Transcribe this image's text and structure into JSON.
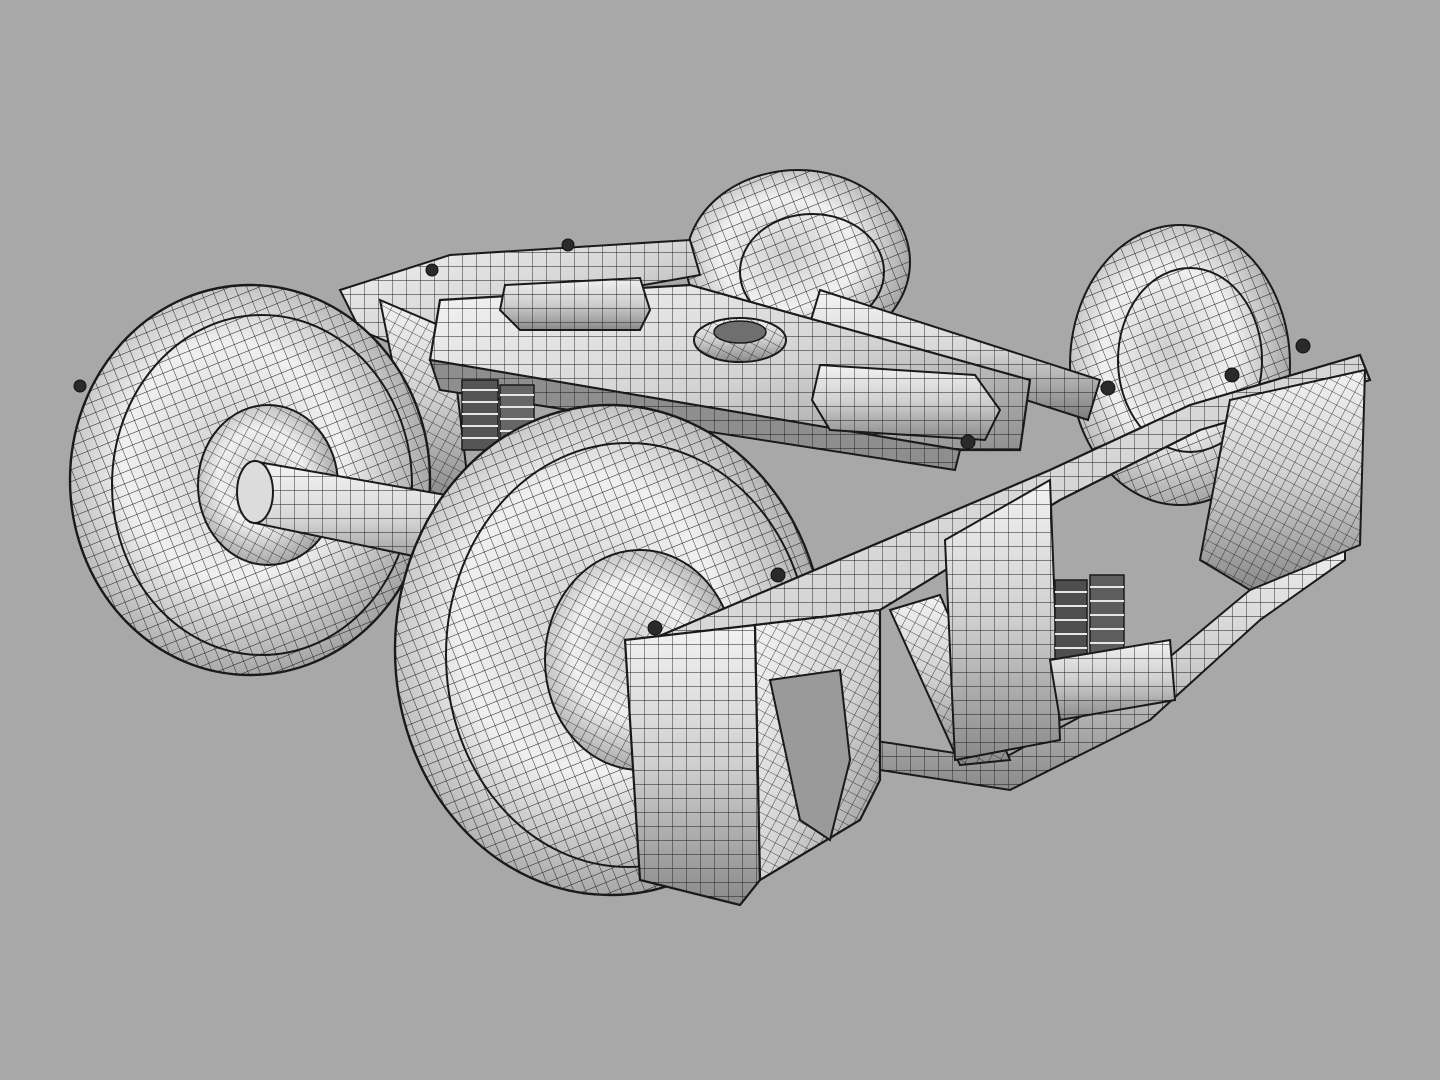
{
  "viewport": {
    "background": "#a8a8a8",
    "shade_light": "#f2f2f2",
    "shade_mid": "#cfcfcf",
    "shade_dark": "#8e8e8e",
    "wire": "#1a1a1a"
  },
  "model": {
    "subject": "railway-bogie-wireframe",
    "shading": "wireframe-on-shaded",
    "wheel_count": 4,
    "axle_count": 2
  }
}
